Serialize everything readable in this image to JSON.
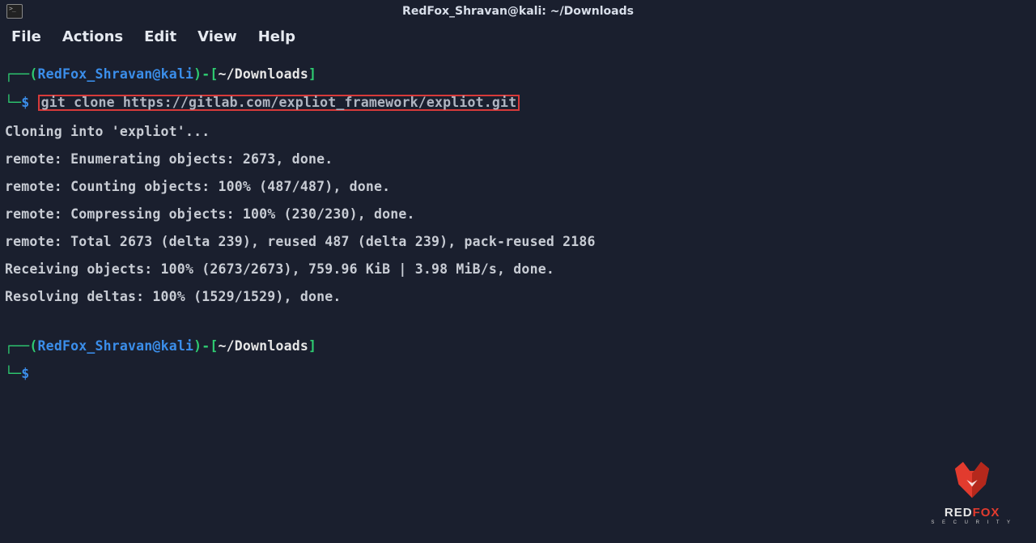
{
  "titlebar": {
    "title": "RedFox_Shravan@kali: ~/Downloads"
  },
  "menubar": {
    "file": "File",
    "actions": "Actions",
    "edit": "Edit",
    "view": "View",
    "help": "Help"
  },
  "prompt1": {
    "open_paren": "(",
    "user": "RedFox_Shravan",
    "at": "@",
    "host": "kali",
    "close_user": ")-[",
    "path": "~/Downloads",
    "close_bracket": "]",
    "symbol": "$",
    "command": "git clone https://gitlab.com/expliot_framework/expliot.git"
  },
  "output": {
    "l1": "Cloning into 'expliot'...",
    "l2": "remote: Enumerating objects: 2673, done.",
    "l3": "remote: Counting objects: 100% (487/487), done.",
    "l4": "remote: Compressing objects: 100% (230/230), done.",
    "l5": "remote: Total 2673 (delta 239), reused 487 (delta 239), pack-reused 2186",
    "l6": "Receiving objects: 100% (2673/2673), 759.96 KiB | 3.98 MiB/s, done.",
    "l7": "Resolving deltas: 100% (1529/1529), done."
  },
  "prompt2": {
    "open_paren": "(",
    "user": "RedFox_Shravan",
    "at": "@",
    "host": "kali",
    "close_user": ")-[",
    "path": "~/Downloads",
    "close_bracket": "]",
    "symbol": "$"
  },
  "logo": {
    "text_red": "RED",
    "text_fox": "FOX",
    "sub": "S E C U R I T Y"
  }
}
